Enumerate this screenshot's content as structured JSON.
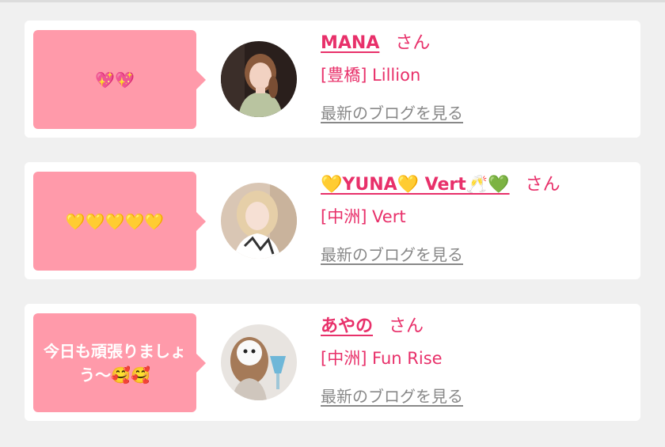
{
  "colors": {
    "accent": "#e8306a",
    "bubble": "#ff9aaa",
    "card": "#ffffff",
    "background": "#f0f0f0",
    "link_gray": "#888888"
  },
  "items": [
    {
      "message": "💖💖",
      "name": "MANA",
      "honorific": "さん",
      "shop": "[豊橋] Lillion",
      "blog_link": "最新のブログを見る",
      "avatar": "avatar-photo-mana"
    },
    {
      "message": "💛💛💛💛💛",
      "name": "💛YUNA💛 Vert🥂💚",
      "honorific": "さん",
      "shop": "[中洲] Vert",
      "blog_link": "最新のブログを見る",
      "avatar": "avatar-photo-yuna"
    },
    {
      "message": "今日も頑張りましょう〜🥰🥰",
      "name": "あやの",
      "honorific": "さん",
      "shop": "[中洲] Fun Rise",
      "blog_link": "最新のブログを見る",
      "avatar": "avatar-photo-ayano"
    }
  ]
}
